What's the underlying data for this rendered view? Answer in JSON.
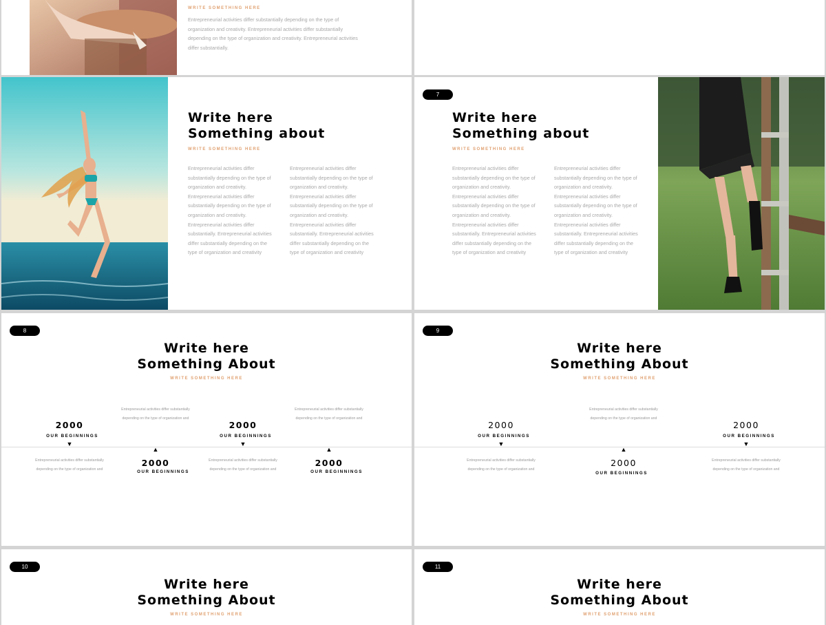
{
  "paragraph_short": "Entrepreneurial activities differ substantially depending on the type of organization and creativity. Entrepreneurial activities differ substantially depending on the type of organization and creativity. Entrepreneurial activities differ substantially.",
  "paragraph_col": "Entrepreneurial activities differ substantially depending on the type of organization and creativity. Entrepreneurial activities differ substantially depending on the type of organization and creativity. Entrepreneurial activities differ substantially. Entrepreneurial activities differ substantially depending on the type of organization and creativity",
  "paragraph_tl": "Entrepreneurial activities differ substantially depending on the type of organization and",
  "subtitle": "WRITE SOMETHING HERE",
  "title_line1": "Write here",
  "title_line2_a": "Something about",
  "title_line2_b": "Something About",
  "timeline_year": "2000",
  "timeline_label": "OUR BEGINNINGS",
  "slides": {
    "s7_badge": "7",
    "s8_badge": "8",
    "s9_badge": "9",
    "s10_badge": "10",
    "s11_badge": "11"
  }
}
